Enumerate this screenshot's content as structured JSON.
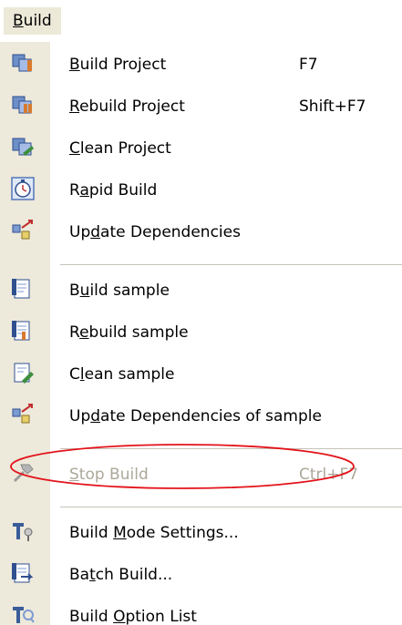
{
  "menu": {
    "title": {
      "pre": "",
      "acc": "B",
      "post": "uild"
    },
    "items": [
      {
        "pre": "",
        "acc": "B",
        "post": "uild Project",
        "shortcut": "F7",
        "icon": "build-project-icon",
        "disabled": false
      },
      {
        "pre": "",
        "acc": "R",
        "post": "ebuild Project",
        "shortcut": "Shift+F7",
        "icon": "rebuild-project-icon",
        "disabled": false
      },
      {
        "pre": "",
        "acc": "C",
        "post": "lean Project",
        "shortcut": "",
        "icon": "clean-project-icon",
        "disabled": false
      },
      {
        "pre": "R",
        "acc": "a",
        "post": "pid Build",
        "shortcut": "",
        "icon": "rapid-build-icon",
        "disabled": false
      },
      {
        "pre": "Up",
        "acc": "d",
        "post": "ate Dependencies",
        "shortcut": "",
        "icon": "update-dependencies-icon",
        "disabled": false
      },
      {
        "pre": "B",
        "acc": "u",
        "post": "ild sample",
        "shortcut": "",
        "icon": "build-sample-icon",
        "disabled": false
      },
      {
        "pre": "R",
        "acc": "e",
        "post": "build sample",
        "shortcut": "",
        "icon": "rebuild-sample-icon",
        "disabled": false
      },
      {
        "pre": "C",
        "acc": "l",
        "post": "ean sample",
        "shortcut": "",
        "icon": "clean-sample-icon",
        "disabled": false
      },
      {
        "pre": "Up",
        "acc": "d",
        "post": "ate Dependencies of sample",
        "shortcut": "",
        "icon": "update-dependencies-sample-icon",
        "disabled": false
      },
      {
        "pre": "",
        "acc": "S",
        "post": "top Build",
        "shortcut": "Ctrl+F7",
        "icon": "stop-build-icon",
        "disabled": true
      },
      {
        "pre": "Build ",
        "acc": "M",
        "post": "ode Settings...",
        "shortcut": "",
        "icon": "build-mode-settings-icon",
        "disabled": false
      },
      {
        "pre": "Ba",
        "acc": "t",
        "post": "ch Build...",
        "shortcut": "",
        "icon": "batch-build-icon",
        "disabled": false
      },
      {
        "pre": "Build ",
        "acc": "O",
        "post": "ption List",
        "shortcut": "",
        "icon": "build-option-list-icon",
        "disabled": false
      }
    ]
  },
  "colors": {
    "gutter": "#ede9db",
    "separator": "#c5c2b8",
    "disabled_text": "#aca899",
    "highlight_ellipse": "#e3141b"
  }
}
